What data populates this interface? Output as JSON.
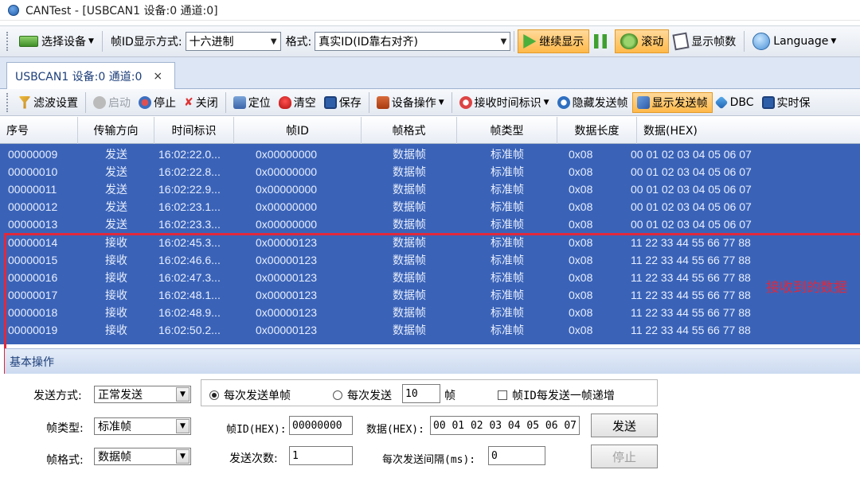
{
  "window": {
    "title": "CANTest  - [USBCAN1 设备:0 通道:0]"
  },
  "toolbar1": {
    "select_device": "选择设备",
    "frame_id_mode_label": "帧ID显示方式:",
    "frame_id_mode_value": "十六进制",
    "format_label": "格式:",
    "format_value": "真实ID(ID靠右对齐)",
    "continue_display": "继续显示",
    "scroll": "滚动",
    "show_frames": "显示帧数",
    "language": "Language"
  },
  "tab": {
    "label": "USBCAN1 设备:0 通道:0",
    "close": "×"
  },
  "toolbar2": {
    "filter": "滤波设置",
    "start": "启动",
    "stop": "停止",
    "close": "关闭",
    "locate": "定位",
    "clear": "清空",
    "save": "保存",
    "device_op": "设备操作",
    "rx_timestamp": "接收时间标识",
    "hide_send": "隐藏发送帧",
    "show_send": "显示发送帧",
    "dbc": "DBC",
    "realtime": "实时保"
  },
  "grid": {
    "headers": [
      "序号",
      "传输方向",
      "时间标识",
      "帧ID",
      "帧格式",
      "帧类型",
      "数据长度",
      "数据(HEX)"
    ],
    "rows": [
      [
        "00000009",
        "发送",
        "16:02:22.0...",
        "0x00000000",
        "数据帧",
        "标准帧",
        "0x08",
        "00 01 02 03 04 05 06 07"
      ],
      [
        "00000010",
        "发送",
        "16:02:22.8...",
        "0x00000000",
        "数据帧",
        "标准帧",
        "0x08",
        "00 01 02 03 04 05 06 07"
      ],
      [
        "00000011",
        "发送",
        "16:02:22.9...",
        "0x00000000",
        "数据帧",
        "标准帧",
        "0x08",
        "00 01 02 03 04 05 06 07"
      ],
      [
        "00000012",
        "发送",
        "16:02:23.1...",
        "0x00000000",
        "数据帧",
        "标准帧",
        "0x08",
        "00 01 02 03 04 05 06 07"
      ],
      [
        "00000013",
        "发送",
        "16:02:23.3...",
        "0x00000000",
        "数据帧",
        "标准帧",
        "0x08",
        "00 01 02 03 04 05 06 07"
      ],
      [
        "00000014",
        "接收",
        "16:02:45.3...",
        "0x00000123",
        "数据帧",
        "标准帧",
        "0x08",
        "11 22 33 44 55 66 77 88"
      ],
      [
        "00000015",
        "接收",
        "16:02:46.6...",
        "0x00000123",
        "数据帧",
        "标准帧",
        "0x08",
        "11 22 33 44 55 66 77 88"
      ],
      [
        "00000016",
        "接收",
        "16:02:47.3...",
        "0x00000123",
        "数据帧",
        "标准帧",
        "0x08",
        "11 22 33 44 55 66 77 88"
      ],
      [
        "00000017",
        "接收",
        "16:02:48.1...",
        "0x00000123",
        "数据帧",
        "标准帧",
        "0x08",
        "11 22 33 44 55 66 77 88"
      ],
      [
        "00000018",
        "接收",
        "16:02:48.9...",
        "0x00000123",
        "数据帧",
        "标准帧",
        "0x08",
        "11 22 33 44 55 66 77 88"
      ],
      [
        "00000019",
        "接收",
        "16:02:50.2...",
        "0x00000123",
        "数据帧",
        "标准帧",
        "0x08",
        "11 22 33 44 55 66 77 88"
      ]
    ]
  },
  "annotation": {
    "label": "接收到的数据",
    "color": "#e0283c"
  },
  "panel": {
    "title": "基本操作",
    "send_mode_label": "发送方式:",
    "send_mode_value": "正常发送",
    "frame_type_label": "帧类型:",
    "frame_type_value": "标准帧",
    "frame_format_label": "帧格式:",
    "frame_format_value": "数据帧",
    "radio_single": "每次发送单帧",
    "radio_multi": "每次发送",
    "multi_count": "10",
    "frames_unit": "帧",
    "increment_label": "帧ID每发送一帧递增",
    "frame_id_label": "帧ID(HEX):",
    "frame_id_value": "00000000",
    "data_label": "数据(HEX):",
    "data_value": "00 01 02 03 04 05 06 07",
    "send_button": "发送",
    "send_count_label": "发送次数:",
    "send_count_value": "1",
    "interval_label": "每次发送间隔(ms):",
    "interval_value": "0",
    "stop_button": "停止"
  },
  "colors": {
    "grid_bg": "#3a63b8",
    "grid_text": "#e8eefc",
    "active_button": "#ffb94a"
  }
}
